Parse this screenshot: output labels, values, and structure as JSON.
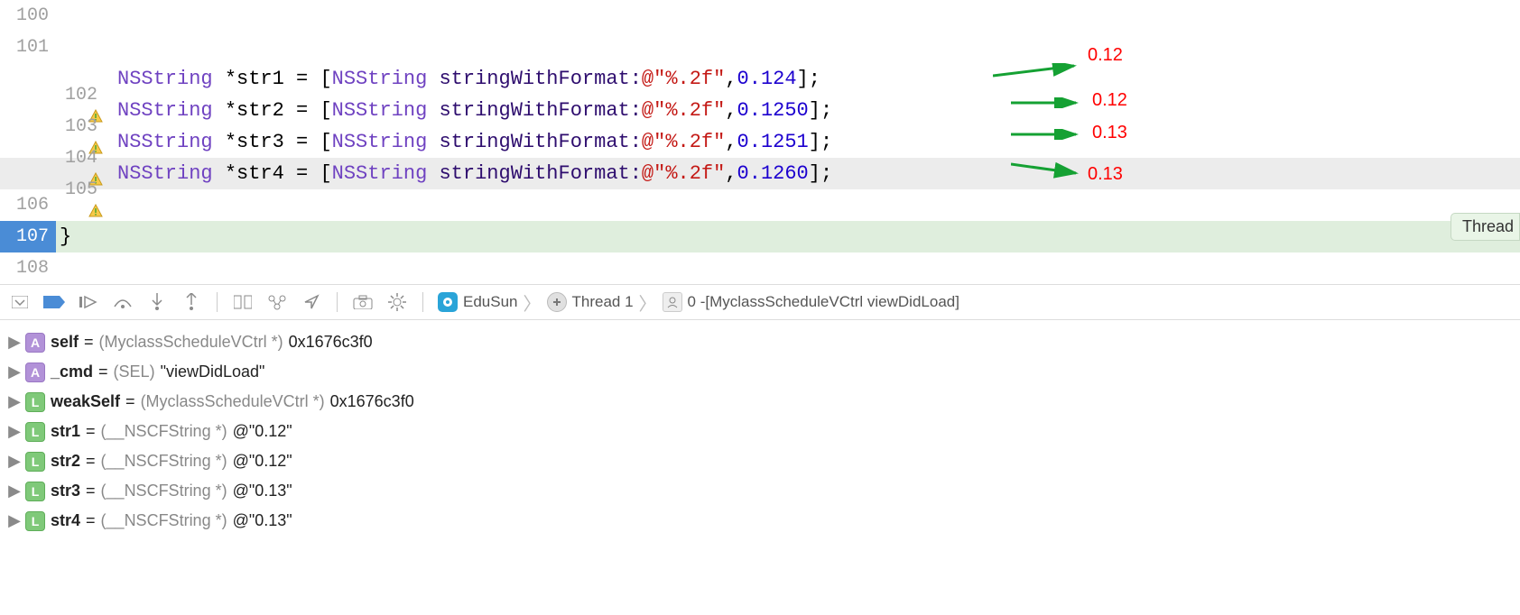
{
  "code": {
    "lines": [
      {
        "num": "100",
        "warn": false,
        "content": null
      },
      {
        "num": "101",
        "warn": false,
        "content": null
      },
      {
        "num": "102",
        "warn": true,
        "var": "str1",
        "literal": "0.124",
        "result": "0.12"
      },
      {
        "num": "103",
        "warn": true,
        "var": "str2",
        "literal": "0.1250",
        "result": "0.12"
      },
      {
        "num": "104",
        "warn": true,
        "var": "str3",
        "literal": "0.1251",
        "result": "0.13"
      },
      {
        "num": "105",
        "warn": true,
        "var": "str4",
        "literal": "0.1260",
        "result": "0.13"
      },
      {
        "num": "106",
        "warn": false,
        "content": null
      },
      {
        "num": "107",
        "warn": false,
        "content": "}"
      },
      {
        "num": "108",
        "warn": false,
        "content": null
      }
    ],
    "type_token": "NSString",
    "method_token": "stringWithFormat:",
    "format_str": "@\"%.2f\"",
    "star": "*",
    "open": " = [",
    "close": "];"
  },
  "thread_tag": "Thread",
  "breadcrumb": {
    "app": "EduSun",
    "thread": "Thread 1",
    "frame": "0 -[MyclassScheduleVCtrl viewDidLoad]"
  },
  "variables": [
    {
      "icon": "A",
      "name": "self",
      "type": "(MyclassScheduleVCtrl *)",
      "value": "0x1676c3f0"
    },
    {
      "icon": "A",
      "name": "_cmd",
      "type": "(SEL)",
      "value": "\"viewDidLoad\""
    },
    {
      "icon": "L",
      "name": "weakSelf",
      "type": "(MyclassScheduleVCtrl *)",
      "value": "0x1676c3f0"
    },
    {
      "icon": "L",
      "name": "str1",
      "type": "(__NSCFString *)",
      "value": "@\"0.12\""
    },
    {
      "icon": "L",
      "name": "str2",
      "type": "(__NSCFString *)",
      "value": "@\"0.12\""
    },
    {
      "icon": "L",
      "name": "str3",
      "type": "(__NSCFString *)",
      "value": "@\"0.13\""
    },
    {
      "icon": "L",
      "name": "str4",
      "type": "(__NSCFString *)",
      "value": "@\"0.13\""
    }
  ]
}
